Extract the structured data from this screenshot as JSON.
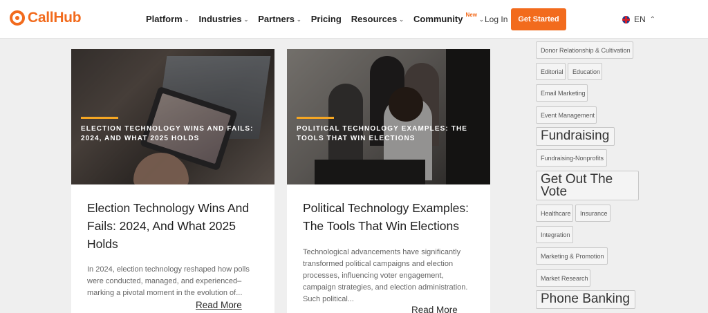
{
  "brand": {
    "name": "CallHub",
    "color": "#f26b1d"
  },
  "nav": {
    "items": [
      {
        "label": "Platform",
        "has_dropdown": true
      },
      {
        "label": "Industries",
        "has_dropdown": true
      },
      {
        "label": "Partners",
        "has_dropdown": true
      },
      {
        "label": "Pricing",
        "has_dropdown": false
      },
      {
        "label": "Resources",
        "has_dropdown": true
      },
      {
        "label": "Community",
        "badge": "New",
        "has_dropdown": true
      }
    ],
    "login": "Log In",
    "cta": "Get Started",
    "language": "EN"
  },
  "posts": [
    {
      "image_caption": "ELECTION TECHNOLOGY WINS AND FAILS: 2024, AND WHAT 2025 HOLDS",
      "title": "Election Technology Wins And Fails: 2024, And What 2025 Holds",
      "excerpt": "In 2024, election technology reshaped how polls were conducted, managed, and experienced– marking a pivotal moment in the evolution of...",
      "read_more": "Read More"
    },
    {
      "image_caption": "POLITICAL TECHNOLOGY EXAMPLES: THE TOOLS THAT WIN ELECTIONS",
      "title": "Political Technology Examples: The Tools That Win Elections",
      "excerpt": "Technological advancements have significantly transformed political campaigns and election processes, influencing voter engagement, campaign strategies, and election administration. Such political...",
      "read_more": "Read More"
    }
  ],
  "tags": [
    "Donor Relationship & Cultivation",
    "Editorial",
    "Education",
    "Email Marketing",
    "Event Management",
    "Fundraising",
    "Fundraising-Nonprofits",
    "Get Out The Vote",
    "Healthcare",
    "Insurance",
    "Integration",
    "Marketing & Promotion",
    "Market Research",
    "Phone Banking"
  ],
  "accent_color": "#f5a623"
}
